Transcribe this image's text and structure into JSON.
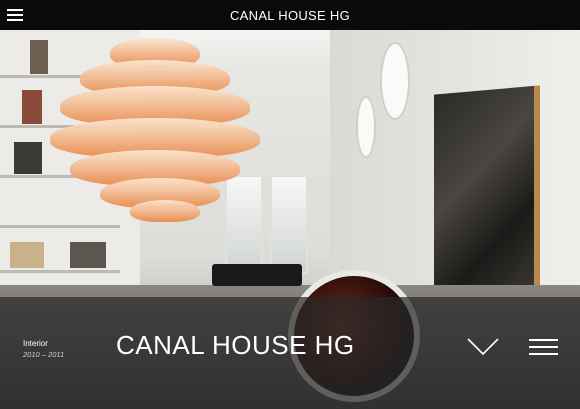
{
  "header": {
    "title": "CANAL HOUSE HG",
    "menu_icon": "hamburger-icon"
  },
  "hero": {
    "image_subject": "interior photo"
  },
  "project": {
    "category": "Interior",
    "years": "2010 – 2011",
    "title": "CANAL HOUSE HG"
  },
  "controls": {
    "scroll_icon": "chevron-down-icon",
    "menu_icon": "menu-lines-icon"
  },
  "colors": {
    "header_bg": "#0a0a0a",
    "overlay_bg": "#282828",
    "text": "#ffffff"
  }
}
